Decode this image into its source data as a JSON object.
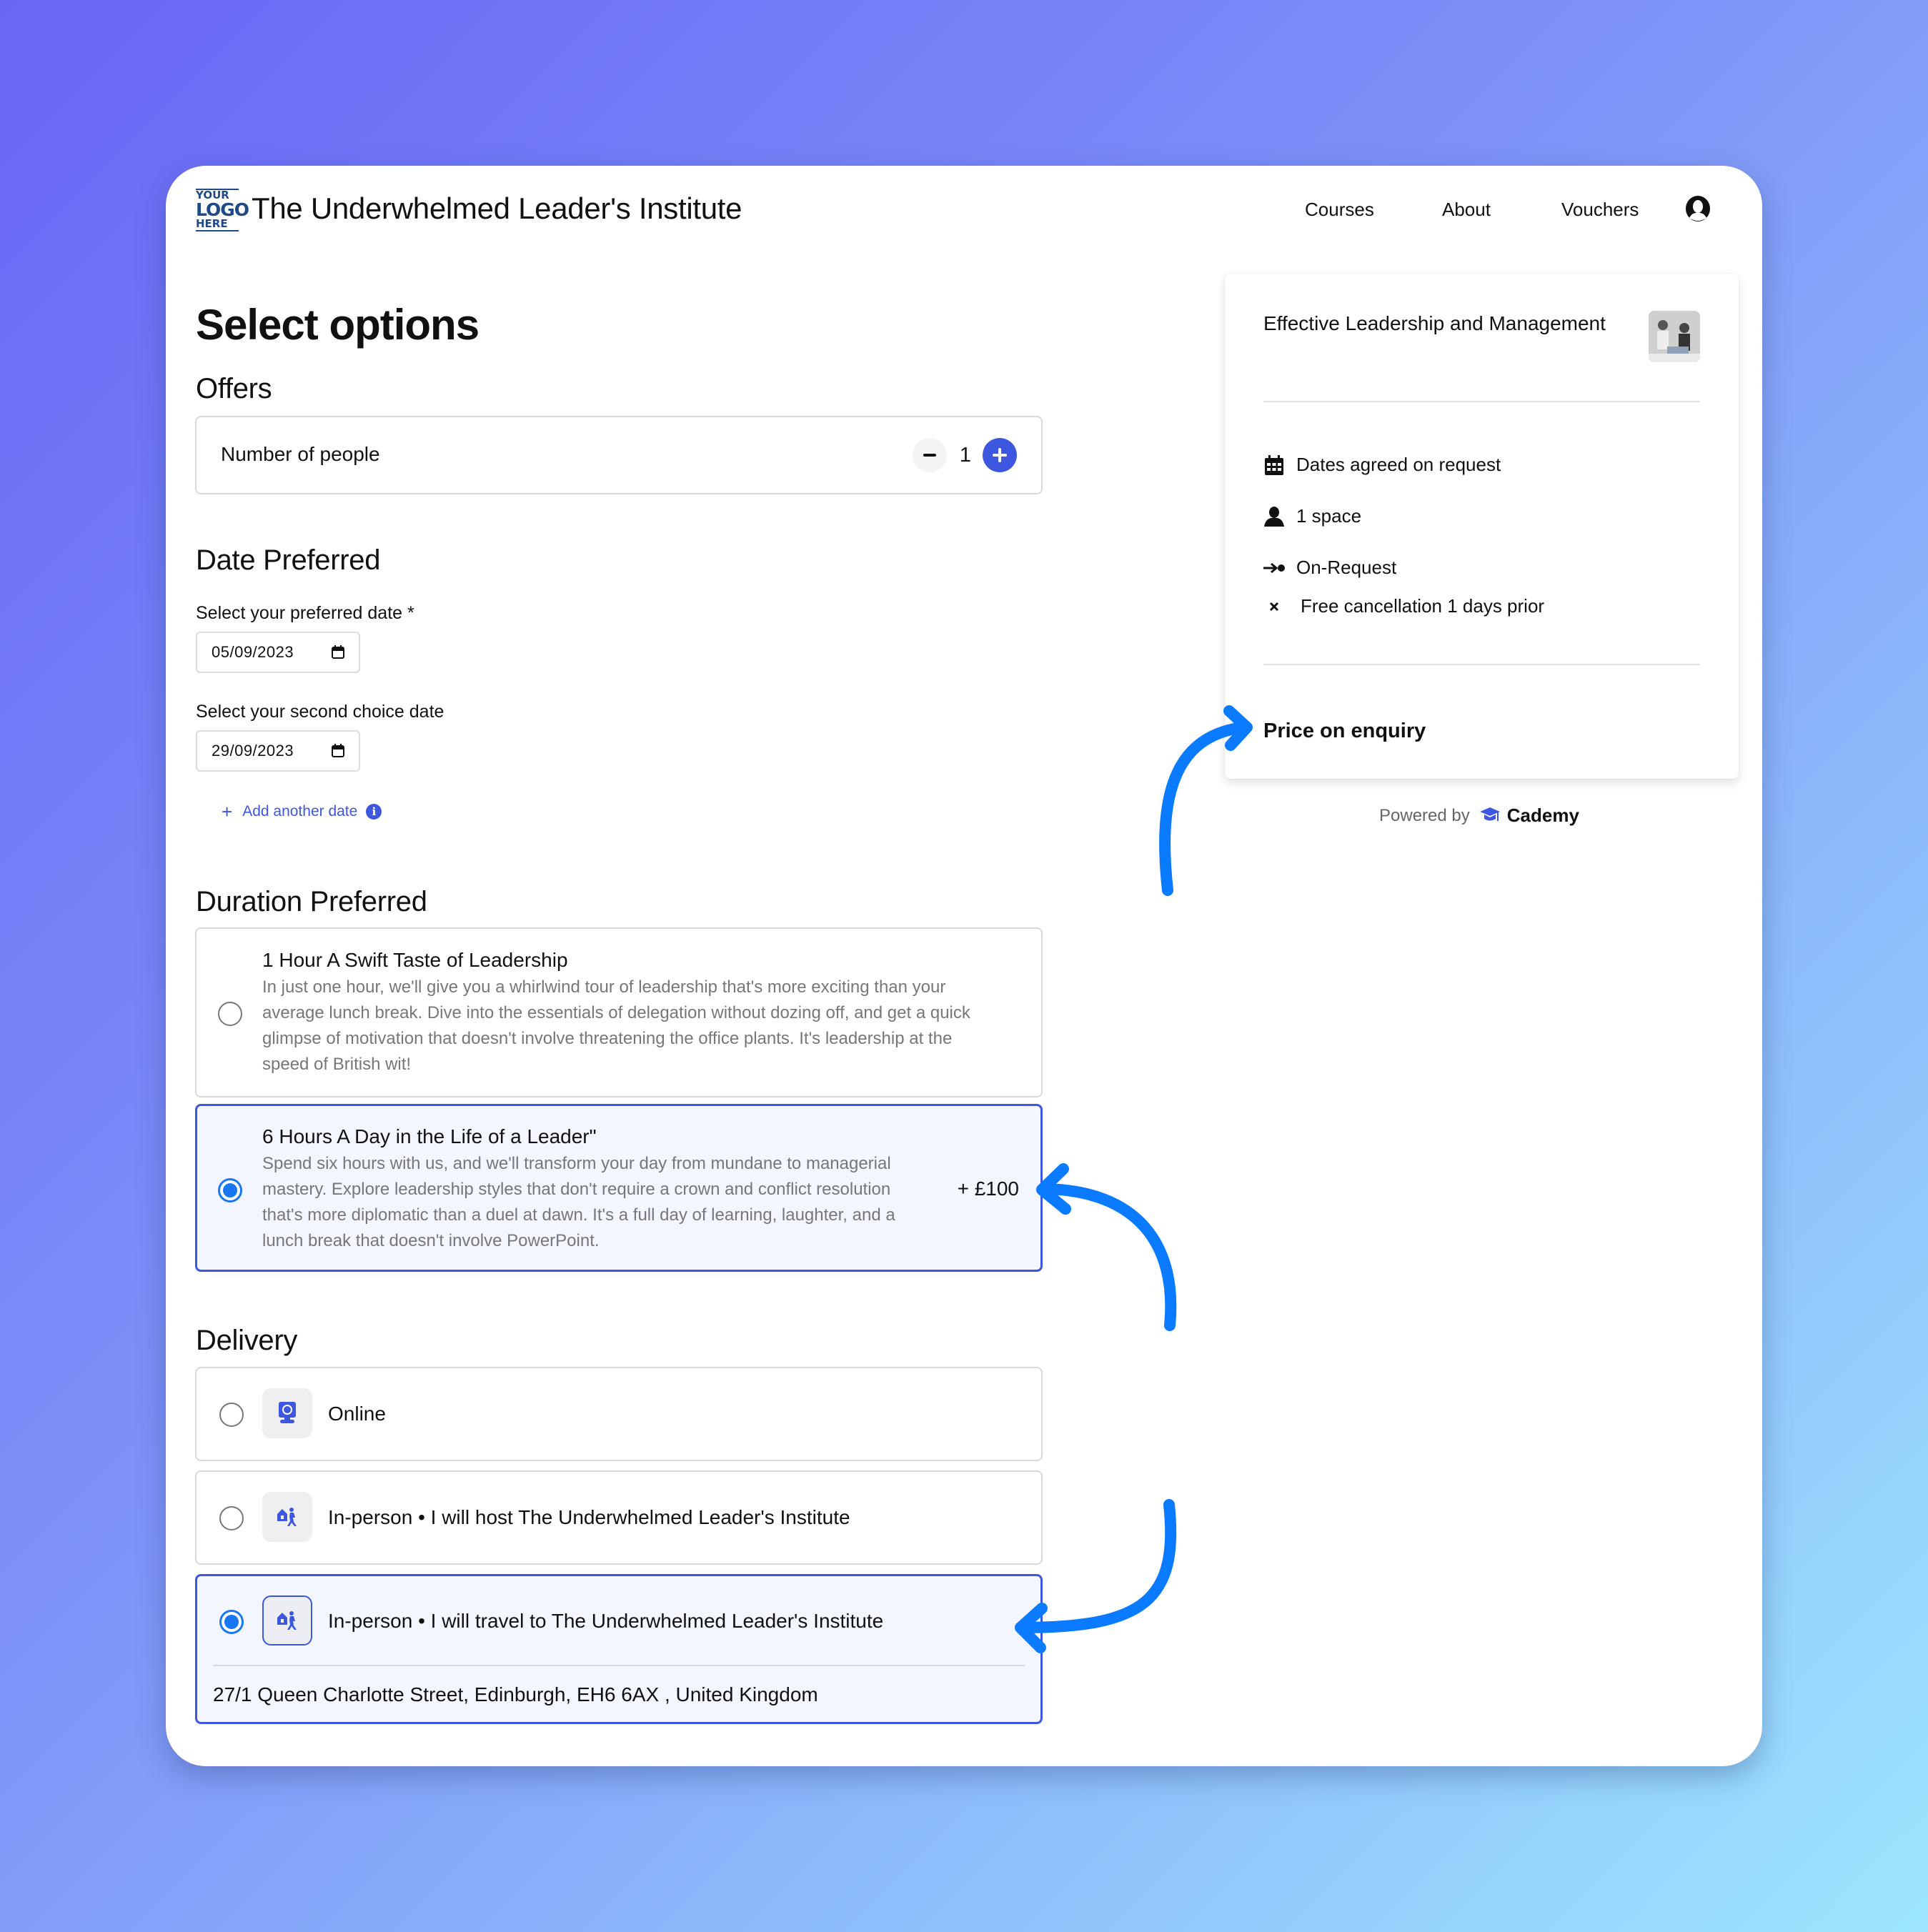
{
  "header": {
    "logo_lines": [
      "YOUR",
      "LOGO",
      "HERE"
    ],
    "site_title": "The Underwhelmed Leader's Institute",
    "nav": [
      {
        "label": "Courses"
      },
      {
        "label": "About"
      },
      {
        "label": "Vouchers"
      }
    ],
    "user_icon": "user-account-icon"
  },
  "page_title": "Select options",
  "offers": {
    "heading": "Offers",
    "people_label": "Number of people",
    "people_count": "1",
    "minus_icon": "minus-icon",
    "plus_icon": "plus-icon"
  },
  "dates": {
    "heading": "Date Preferred",
    "preferred_label": "Select your preferred date *",
    "preferred_value": "05/09/2023",
    "second_label": "Select your second choice date",
    "second_value": "29/09/2023",
    "add_label": "Add another date",
    "add_icon": "plus-icon",
    "info_icon": "info-icon",
    "info_glyph": "i"
  },
  "duration": {
    "heading": "Duration Preferred",
    "options": [
      {
        "title": "1 Hour A Swift Taste of Leadership",
        "description": "In just one hour, we'll give you a whirlwind tour of leadership that's more exciting than your average lunch break. Dive into the essentials of delegation without dozing off, and get a quick glimpse of motivation that doesn't involve threatening the office plants. It's leadership at the speed of British wit!",
        "price": "",
        "selected": false
      },
      {
        "title": "6 Hours  A Day in the Life of a Leader\"",
        "description": "Spend six hours with us, and we'll transform your day from mundane to managerial mastery. Explore leadership styles that don't require a crown and conflict resolution that's more diplomatic than a duel at dawn. It's a full day of learning, laughter, and a lunch break that doesn't involve PowerPoint.",
        "price": "+ £100",
        "selected": true
      }
    ]
  },
  "delivery": {
    "heading": "Delivery",
    "options": [
      {
        "label": "Online",
        "icon": "webcam-icon",
        "selected": false
      },
      {
        "label": "In-person • I will host The Underwhelmed Leader's Institute",
        "icon": "host-person-icon",
        "selected": false
      },
      {
        "label": "In-person • I will travel to The Underwhelmed Leader's Institute",
        "icon": "travel-person-icon",
        "selected": true,
        "address": "27/1 Queen Charlotte Street, Edinburgh, EH6 6AX , United Kingdom"
      }
    ]
  },
  "summary": {
    "course_title": "Effective Leadership and Management",
    "thumbnail": "course-thumbnail-image",
    "meta": [
      {
        "icon": "calendar-icon",
        "text": "Dates agreed on request"
      },
      {
        "icon": "person-icon",
        "text": "1 space"
      },
      {
        "icon": "arrow-to-dot-icon",
        "text": "On-Request"
      },
      {
        "icon": "close-x-icon",
        "text": "Free cancellation 1 days prior"
      }
    ],
    "price": "Price on enquiry"
  },
  "footer": {
    "powered_by": "Powered by",
    "brand": "Cademy",
    "brand_icon": "graduation-cap-icon"
  },
  "colors": {
    "accent": "#3d57e0",
    "radio_selected": "#1877f2",
    "annotation_arrow": "#0a7bff",
    "background_start": "#6966f6",
    "background_end": "#9de6fe"
  }
}
